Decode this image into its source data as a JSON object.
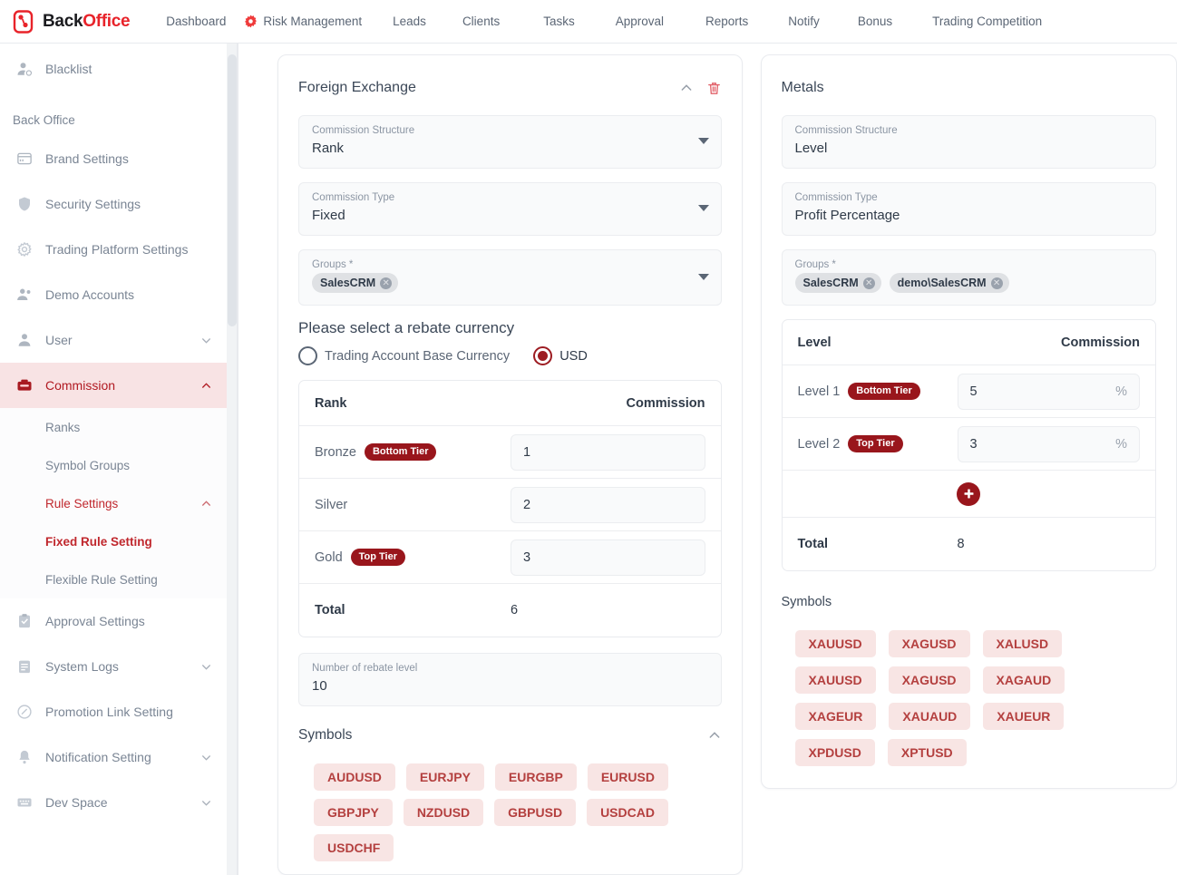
{
  "brand": {
    "part1": "Back",
    "part2": "Office"
  },
  "nav": {
    "items": [
      {
        "label": "Dashboard",
        "icon": null
      },
      {
        "label": "Risk Management",
        "icon": "gear-icon"
      },
      {
        "label": "Leads",
        "icon": null
      },
      {
        "label": "Clients",
        "icon": null
      },
      {
        "label": "Tasks",
        "icon": null
      },
      {
        "label": "Approval",
        "icon": null
      },
      {
        "label": "Reports",
        "icon": null
      },
      {
        "label": "Notify",
        "icon": null
      },
      {
        "label": "Bonus",
        "icon": null
      },
      {
        "label": "Trading Competition",
        "icon": null
      }
    ]
  },
  "sidebar": {
    "section_label": "Back Office",
    "top_item": {
      "label": "Blacklist",
      "icon": "user-blocked-icon"
    },
    "items": [
      {
        "label": "Brand Settings",
        "icon": "card-icon",
        "caret": false
      },
      {
        "label": "Security Settings",
        "icon": "shield-icon",
        "caret": false
      },
      {
        "label": "Trading Platform Settings",
        "icon": "gear-icon",
        "caret": false
      },
      {
        "label": "Demo Accounts",
        "icon": "users-icon",
        "caret": false
      },
      {
        "label": "User",
        "icon": "user-icon",
        "caret": true,
        "caret_dir": "down"
      },
      {
        "label": "Commission",
        "icon": "wallet-icon",
        "caret": true,
        "caret_dir": "up",
        "active": true
      },
      {
        "label": "Approval Settings",
        "icon": "clipboard-check-icon",
        "caret": false
      },
      {
        "label": "System Logs",
        "icon": "notebook-icon",
        "caret": true,
        "caret_dir": "down"
      },
      {
        "label": "Promotion Link Setting",
        "icon": "link-icon",
        "caret": false
      },
      {
        "label": "Notification Setting",
        "icon": "bell-icon",
        "caret": true,
        "caret_dir": "down"
      },
      {
        "label": "Dev Space",
        "icon": "keyboard-icon",
        "caret": true,
        "caret_dir": "down"
      }
    ],
    "commission_children": [
      {
        "label": "Ranks",
        "style": "normal"
      },
      {
        "label": "Symbol Groups",
        "style": "normal"
      },
      {
        "label": "Rule Settings",
        "style": "red",
        "caret": true,
        "caret_dir": "up"
      },
      {
        "label": "Fixed Rule Setting",
        "style": "bold-red"
      },
      {
        "label": "Flexible Rule Setting",
        "style": "normal"
      }
    ]
  },
  "fx_card": {
    "title": "Foreign Exchange",
    "collapse_icon": "chevron-up-icon",
    "delete_icon": "trash-icon",
    "fields": [
      {
        "label": "Commission Structure",
        "value": "Rank"
      },
      {
        "label": "Commission Type",
        "value": "Fixed"
      }
    ],
    "groups": {
      "label": "Groups *",
      "chips": [
        "SalesCRM"
      ]
    },
    "rebate_currency": {
      "title": "Please select a rebate currency",
      "options": [
        {
          "label": "Trading Account Base Currency",
          "selected": false
        },
        {
          "label": "USD",
          "selected": true
        }
      ]
    },
    "table": {
      "col_left": "Rank",
      "col_right": "Commission",
      "rows": [
        {
          "name": "Bronze",
          "badge": "Bottom Tier",
          "value": "1"
        },
        {
          "name": "Silver",
          "badge": null,
          "value": "2"
        },
        {
          "name": "Gold",
          "badge": "Top Tier",
          "value": "3"
        }
      ],
      "total_label": "Total",
      "total_value": "6"
    },
    "rebate_level": {
      "label": "Number of rebate level",
      "value": "10"
    },
    "symbols": {
      "title": "Symbols",
      "collapse_icon": "chevron-up-icon",
      "list": [
        "AUDUSD",
        "EURJPY",
        "EURGBP",
        "EURUSD",
        "GBPJPY",
        "NZDUSD",
        "GBPUSD",
        "USDCAD",
        "USDCHF"
      ]
    }
  },
  "metals_card": {
    "title": "Metals",
    "fields": [
      {
        "label": "Commission Structure",
        "value": "Level"
      },
      {
        "label": "Commission Type",
        "value": "Profit Percentage"
      }
    ],
    "groups": {
      "label": "Groups *",
      "chips": [
        "SalesCRM",
        "demo\\SalesCRM"
      ]
    },
    "table": {
      "col_left": "Level",
      "col_right": "Commission",
      "rows": [
        {
          "name": "Level 1",
          "badge": "Bottom Tier",
          "value": "5",
          "unit": "%"
        },
        {
          "name": "Level 2",
          "badge": "Top Tier",
          "value": "3",
          "unit": "%"
        }
      ],
      "add_label": "+",
      "total_label": "Total",
      "total_value": "8"
    },
    "symbols": {
      "title": "Symbols",
      "list": [
        "XAUUSD",
        "XAGUSD",
        "XALUSD",
        "XAUUSD",
        "XAGUSD",
        "XAGAUD",
        "XAGEUR",
        "XAUAUD",
        "XAUEUR",
        "XPDUSD",
        "XPTUSD"
      ]
    }
  },
  "colors": {
    "brand_red": "#e8232a",
    "accent_red": "#c0272d",
    "badge_red": "#99161c",
    "active_bg": "#f8e3e4",
    "chip_bg": "#f8e5e4",
    "chip_text": "#b4403f",
    "muted_text": "#7a8594"
  }
}
